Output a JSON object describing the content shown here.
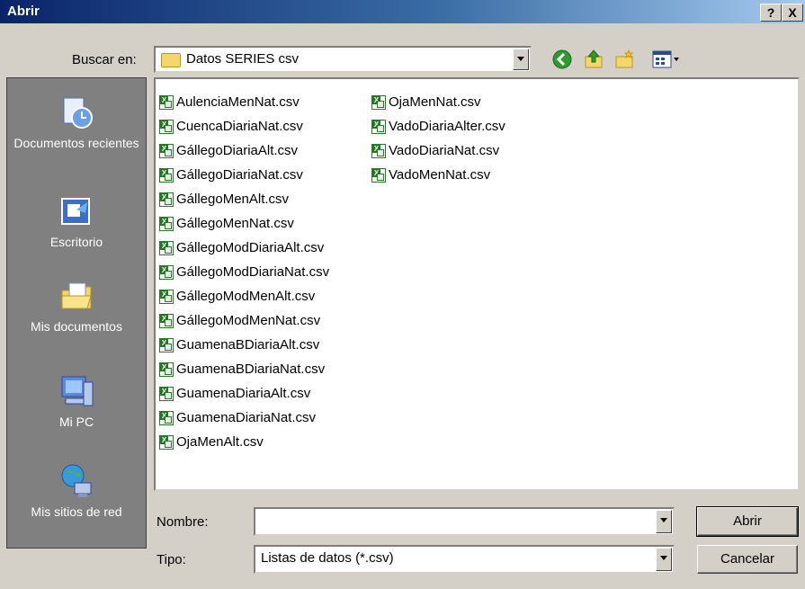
{
  "window": {
    "title": "Abrir",
    "help_label": "?",
    "close_label": "X"
  },
  "lookin": {
    "label": "Buscar en:",
    "value": "Datos SERIES csv"
  },
  "toolbar": {
    "back_icon": "back-icon",
    "up_icon": "up-folder-icon",
    "new_folder_icon": "new-folder-icon",
    "views_icon": "views-menu-icon"
  },
  "places": [
    {
      "label": "Documentos recientes",
      "icon": "recent-documents-icon"
    },
    {
      "label": "Escritorio",
      "icon": "desktop-icon"
    },
    {
      "label": "Mis documentos",
      "icon": "my-documents-icon"
    },
    {
      "label": "Mi PC",
      "icon": "my-computer-icon"
    },
    {
      "label": "Mis sitios de red",
      "icon": "network-places-icon"
    }
  ],
  "files": {
    "column1": [
      "AulenciaMenNat.csv",
      "CuencaDiariaNat.csv",
      "GállegoDiariaAlt.csv",
      "GállegoDiariaNat.csv",
      "GállegoMenAlt.csv",
      "GállegoMenNat.csv",
      "GállegoModDiariaAlt.csv",
      "GállegoModDiariaNat.csv",
      "GállegoModMenAlt.csv",
      "GállegoModMenNat.csv",
      "GuamenaBDiariaAlt.csv",
      "GuamenaBDiariaNat.csv",
      "GuamenaDiariaAlt.csv",
      "GuamenaDiariaNat.csv",
      "OjaMenAlt.csv"
    ],
    "column2": [
      "OjaMenNat.csv",
      "VadoDiariaAlter.csv",
      "VadoDiariaNat.csv",
      "VadoMenNat.csv"
    ]
  },
  "filename": {
    "label": "Nombre:",
    "value": ""
  },
  "filetype": {
    "label": "Tipo:",
    "value": "Listas de datos (*.csv)"
  },
  "buttons": {
    "open": "Abrir",
    "cancel": "Cancelar"
  },
  "colors": {
    "titlebar_start": "#0a246a",
    "titlebar_end": "#a6caf0",
    "face": "#d4d0c8",
    "places_bg": "#808080"
  }
}
